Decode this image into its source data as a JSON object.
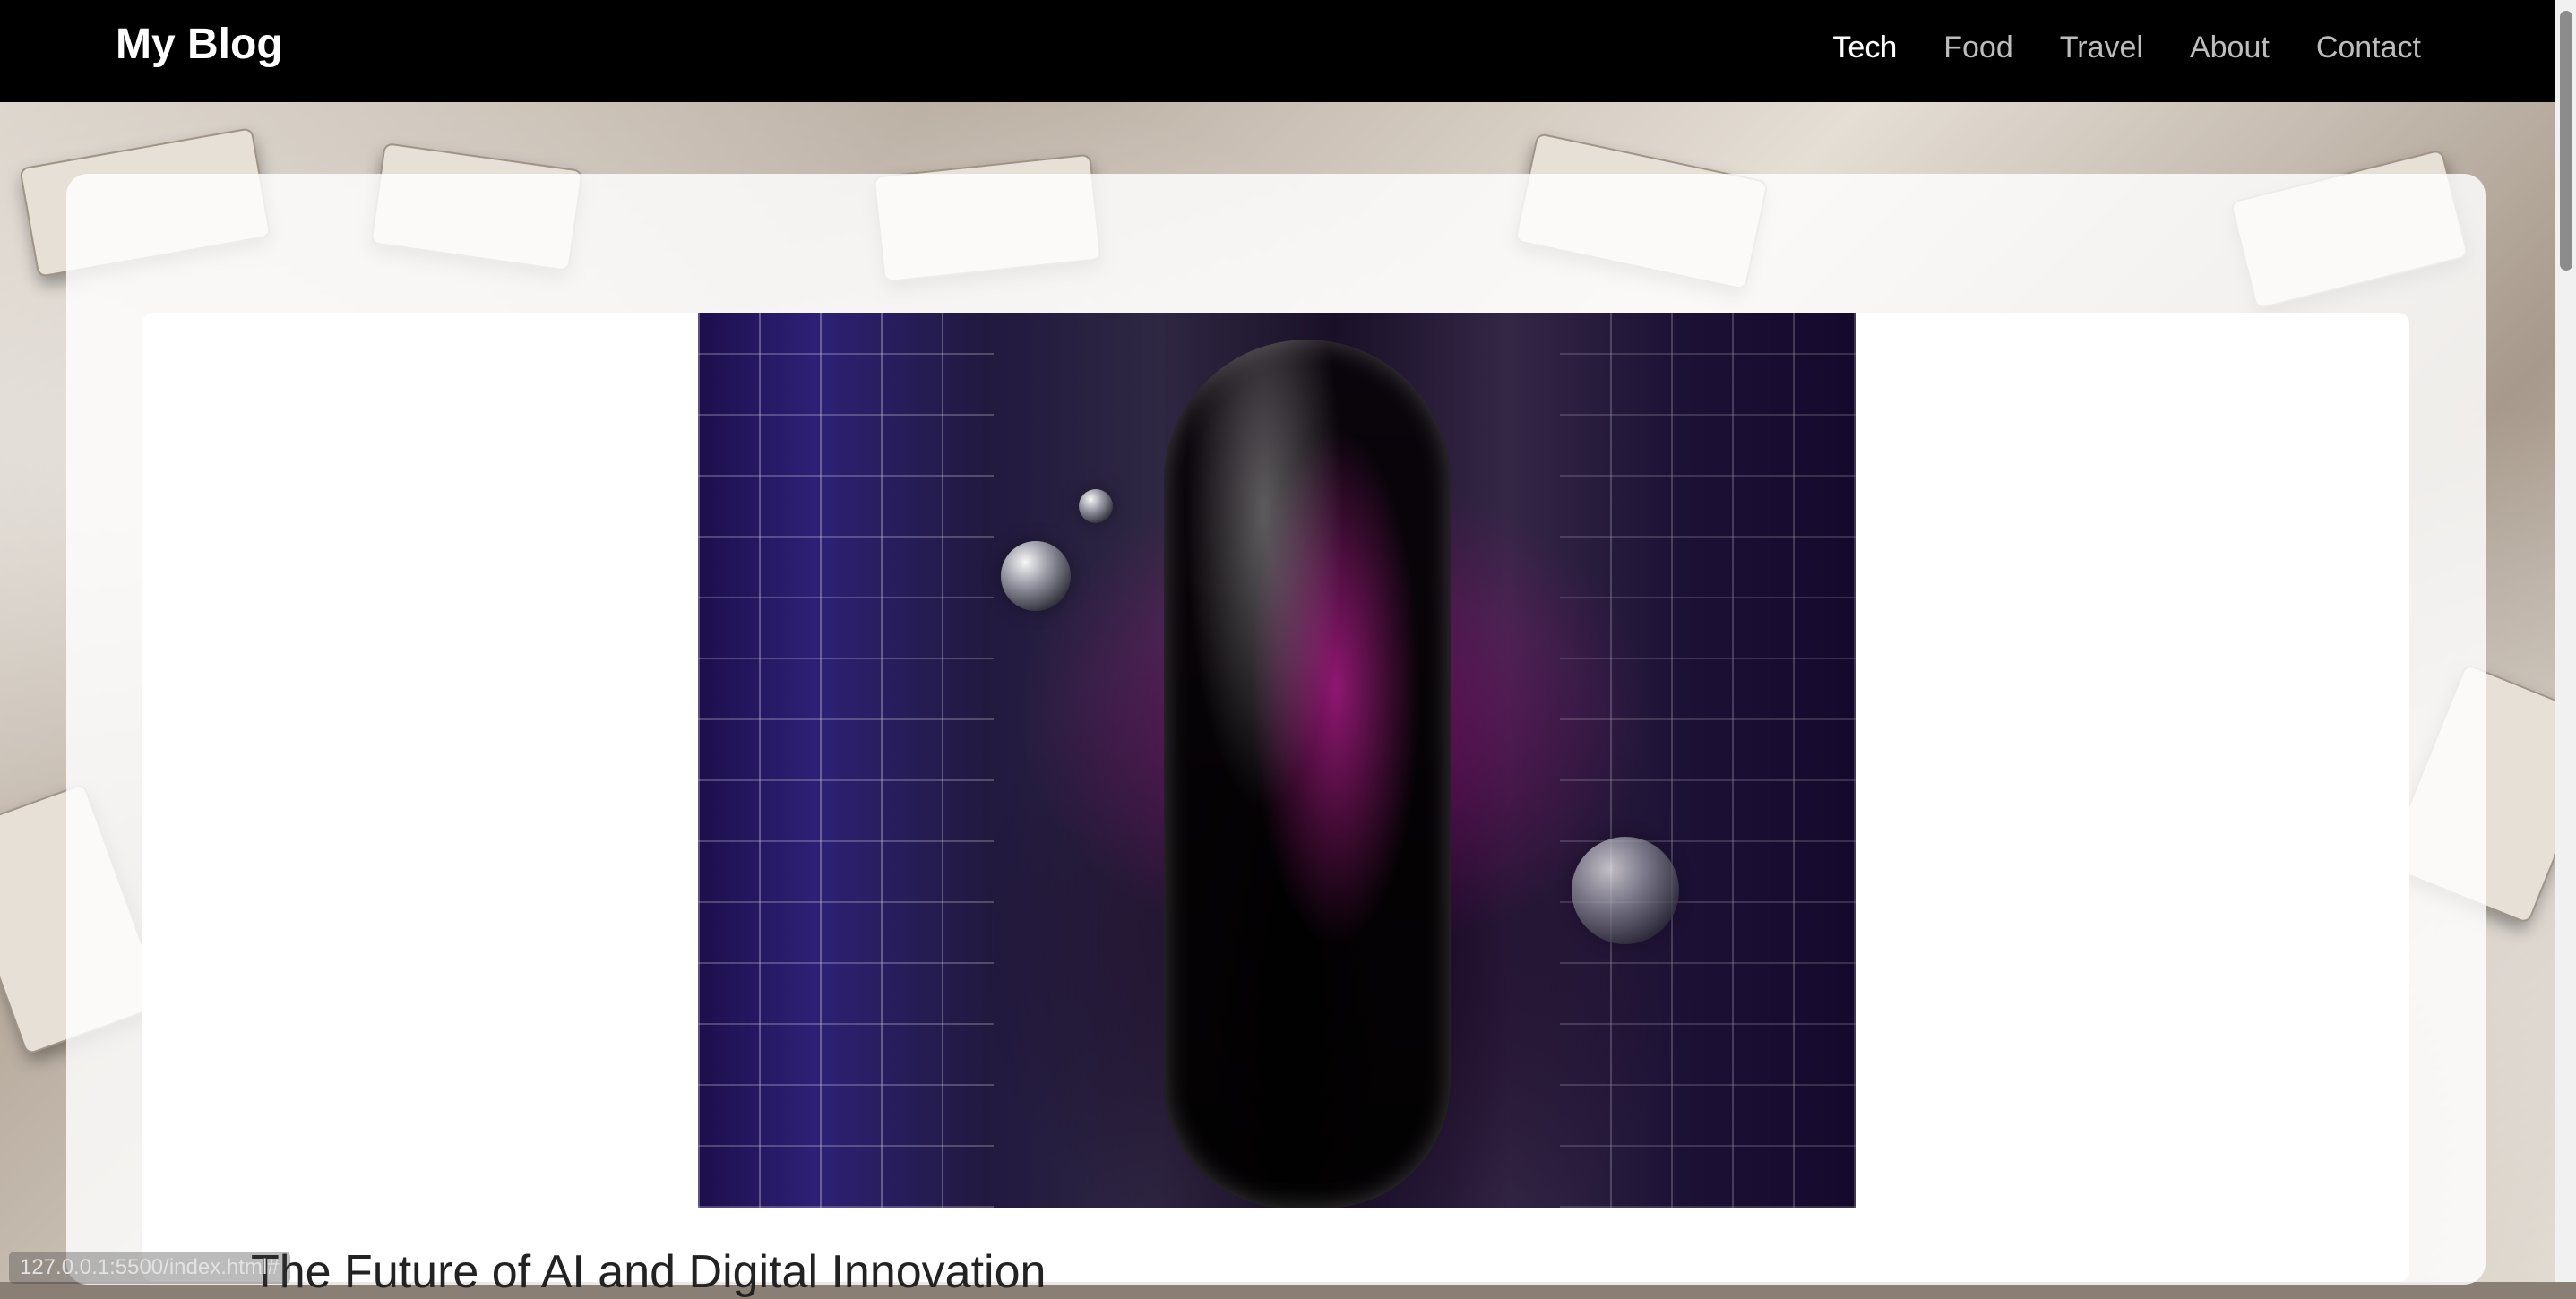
{
  "header": {
    "brand": "My Blog",
    "nav": [
      {
        "label": "Tech",
        "active": true
      },
      {
        "label": "Food",
        "active": false
      },
      {
        "label": "Travel",
        "active": false
      },
      {
        "label": "About",
        "active": false
      },
      {
        "label": "Contact",
        "active": false
      }
    ]
  },
  "post": {
    "image_icon": "ai-figure-image",
    "title": "The Future of AI and Digital Innovation"
  },
  "status": {
    "url_preview": "127.0.0.1:5500/index.html#"
  }
}
